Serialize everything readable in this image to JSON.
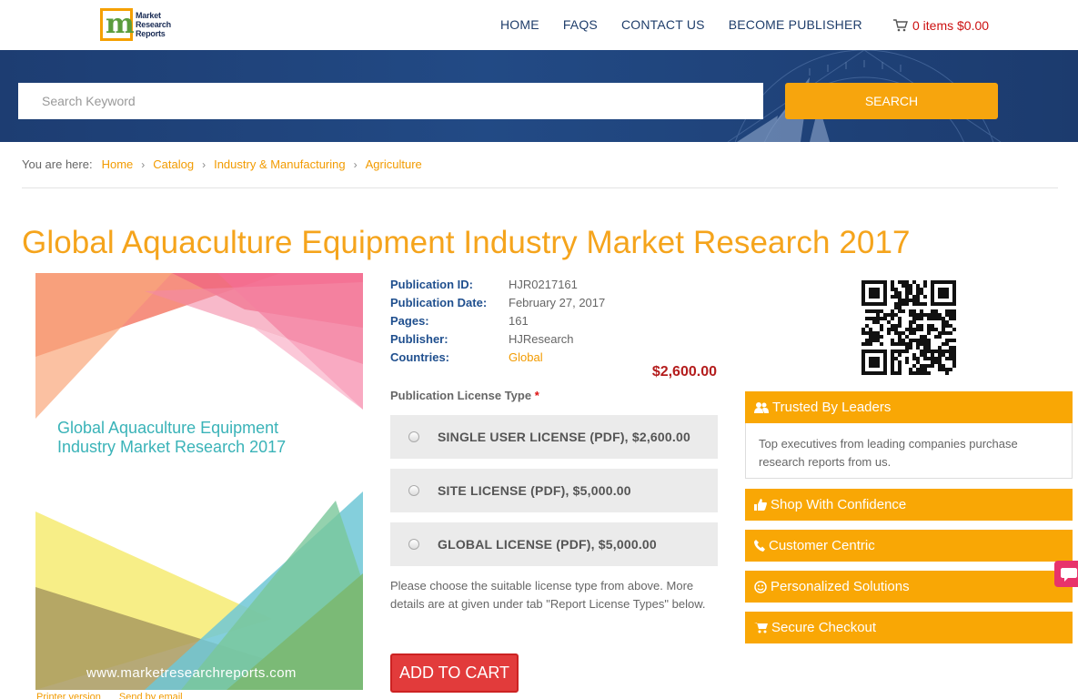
{
  "brand": {
    "logo_letter": "m",
    "logo_line1": "Market",
    "logo_line2": "Research",
    "logo_line3": "Reports"
  },
  "nav": {
    "items": [
      "HOME",
      "FAQS",
      "CONTACT US",
      "BECOME PUBLISHER"
    ],
    "cart_text": "0 items $0.00"
  },
  "search": {
    "placeholder": "Search Keyword",
    "button_label": "SEARCH"
  },
  "breadcrumb": {
    "lead": "You are here:",
    "items": [
      "Home",
      "Catalog",
      "Industry & Manufacturing",
      "Agriculture"
    ]
  },
  "report": {
    "title": "Global Aquaculture Equipment Industry Market Research 2017",
    "cover_title": "Global Aquaculture Equipment Industry Market Research 2017",
    "cover_url": "www.marketresearchreports.com",
    "details": [
      {
        "label": "Publication ID:",
        "value": "HJR0217161"
      },
      {
        "label": "Publication Date:",
        "value": "February 27, 2017"
      },
      {
        "label": "Pages:",
        "value": "161"
      },
      {
        "label": "Publisher:",
        "value": "HJResearch"
      },
      {
        "label": "Countries:",
        "value": "Global"
      }
    ],
    "price": "$2,600.00"
  },
  "license": {
    "heading": "Publication License Type",
    "required_mark": "*",
    "options": [
      "SINGLE USER LICENSE (PDF), $2,600.00",
      "SITE LICENSE (PDF), $5,000.00",
      "GLOBAL LICENSE (PDF), $5,000.00"
    ],
    "note": "Please choose the suitable license type from above. More details are at given under tab \"Report License Types\" below.",
    "add_to_cart": "ADD TO CART"
  },
  "below_cover": [
    "Printer version",
    "Send by email"
  ],
  "trust": {
    "items": [
      {
        "label": "Trusted By Leaders",
        "icon": "users-icon"
      },
      {
        "label": "Shop With Confidence",
        "icon": "thumbs-up-icon"
      },
      {
        "label": "Customer Centric",
        "icon": "phone-icon"
      },
      {
        "label": "Personalized Solutions",
        "icon": "smile-icon"
      },
      {
        "label": "Secure Checkout",
        "icon": "cart-icon"
      }
    ],
    "body": "Top executives from leading companies purchase research reports from us."
  },
  "colors": {
    "accent": "#f5a41c",
    "nav": "#1f3e6b",
    "price": "#b41d1d",
    "add_to_cart": "#e23b3b",
    "banner": "#1d3d72"
  }
}
